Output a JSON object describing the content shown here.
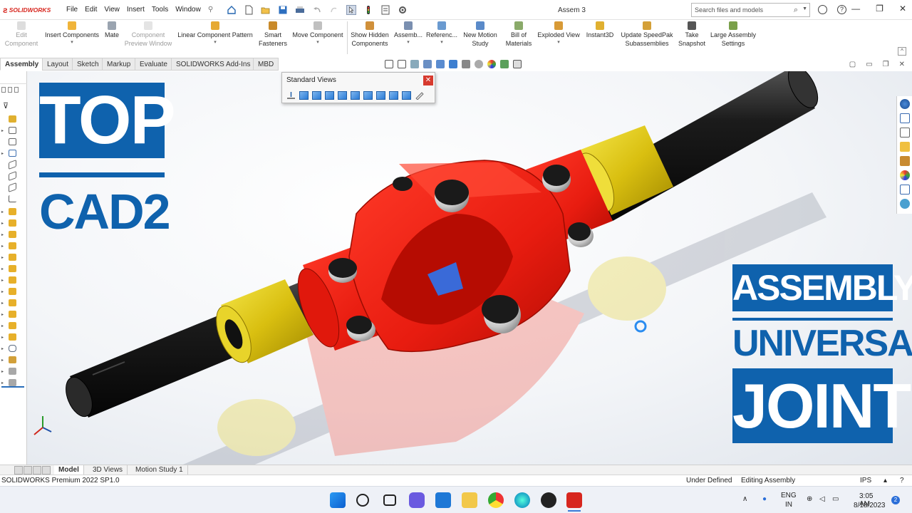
{
  "app": {
    "logo_text": "SOLIDWORKS",
    "document_title": "Assem 3"
  },
  "menu": [
    "File",
    "Edit",
    "View",
    "Insert",
    "Tools",
    "Window"
  ],
  "search": {
    "placeholder": "Search files and models"
  },
  "command_manager": {
    "buttons": [
      {
        "label": "Edit\nComponent",
        "disabled": true
      },
      {
        "label": "Insert Components",
        "disabled": false
      },
      {
        "label": "Mate",
        "disabled": false
      },
      {
        "label": "Component\nPreview Window",
        "disabled": true
      },
      {
        "label": "Linear Component Pattern",
        "disabled": false
      },
      {
        "label": "Smart\nFasteners",
        "disabled": false
      },
      {
        "label": "Move Component",
        "disabled": false
      },
      {
        "label": "Show Hidden\nComponents",
        "disabled": false
      },
      {
        "label": "Assemb...",
        "disabled": false
      },
      {
        "label": "Referenc...",
        "disabled": false
      },
      {
        "label": "New Motion\nStudy",
        "disabled": false
      },
      {
        "label": "Bill of\nMaterials",
        "disabled": false
      },
      {
        "label": "Exploded View",
        "disabled": false
      },
      {
        "label": "Instant3D",
        "disabled": false
      },
      {
        "label": "Update SpeedPak\nSubassemblies",
        "disabled": false
      },
      {
        "label": "Take\nSnapshot",
        "disabled": false
      },
      {
        "label": "Large Assembly\nSettings",
        "disabled": false
      }
    ]
  },
  "tabs": [
    "Assembly",
    "Layout",
    "Sketch",
    "Markup",
    "Evaluate",
    "SOLIDWORKS Add-Ins",
    "MBD"
  ],
  "active_tab": "Assembly",
  "standard_views": {
    "title": "Standard Views",
    "close_label": "✕"
  },
  "overlay": {
    "top": "TOP",
    "cad": "CAD2",
    "assembly": "ASSEMBLY",
    "universal": "UNIVERSAL",
    "joint": "JOINT"
  },
  "bottom_tabs": [
    "Model",
    "3D Views",
    "Motion Study 1"
  ],
  "active_bottom_tab": "Model",
  "status": {
    "version": "SOLIDWORKS Premium 2022 SP1.0",
    "state": "Under Defined",
    "mode": "Editing Assembly",
    "units": "IPS"
  },
  "tray": {
    "lang1": "ENG",
    "lang2": "IN",
    "time": "3:05 AM",
    "date": "8/18/2023",
    "notifications": "2"
  },
  "colors": {
    "brand_red": "#d7261e",
    "title_blue": "#0f62ad",
    "yoke_red": "#e81c10",
    "bearing_yellow": "#e2cb16",
    "shaft_black": "#1b1b1b"
  }
}
